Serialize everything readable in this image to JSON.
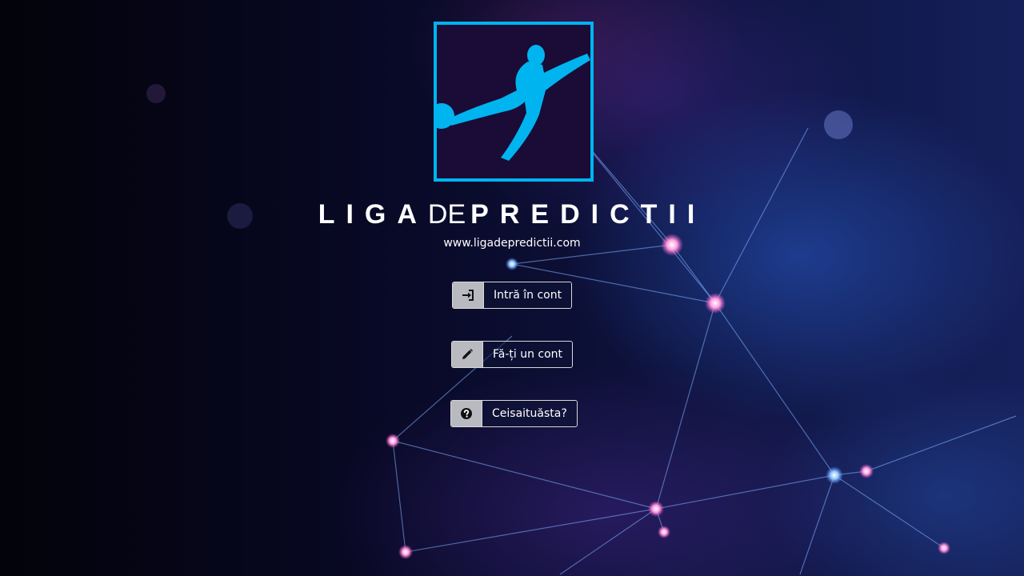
{
  "brand": {
    "part1": "LIGA",
    "part2": "DE",
    "part3": "PREDICTII",
    "website": "www.ligadepredictii.com",
    "logo_icon": "football-player-kick-icon",
    "accent_color": "#00b4ef"
  },
  "actions": [
    {
      "label": "Intră în cont",
      "icon": "sign-in-icon"
    },
    {
      "label": "Fă-ți un cont",
      "icon": "pencil-icon"
    },
    {
      "label": "Ceisaituăsta?",
      "icon": "question-circle-icon"
    }
  ]
}
